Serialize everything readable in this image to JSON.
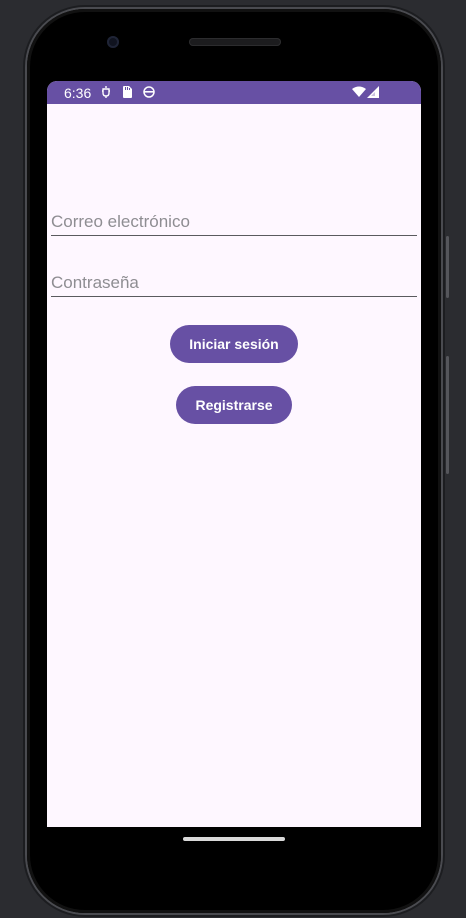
{
  "status_bar": {
    "time": "6:36",
    "icons": [
      "debug-icon",
      "sd-card-icon",
      "android-icon",
      "wifi-icon",
      "signal-icon"
    ],
    "color": "#6750a4"
  },
  "login_form": {
    "email_placeholder": "Correo electrónico",
    "email_value": "",
    "password_placeholder": "Contraseña",
    "password_value": "",
    "login_label": "Iniciar sesión",
    "register_label": "Registrarse"
  },
  "theme": {
    "primary": "#6750a4",
    "background": "#fef7ff"
  }
}
